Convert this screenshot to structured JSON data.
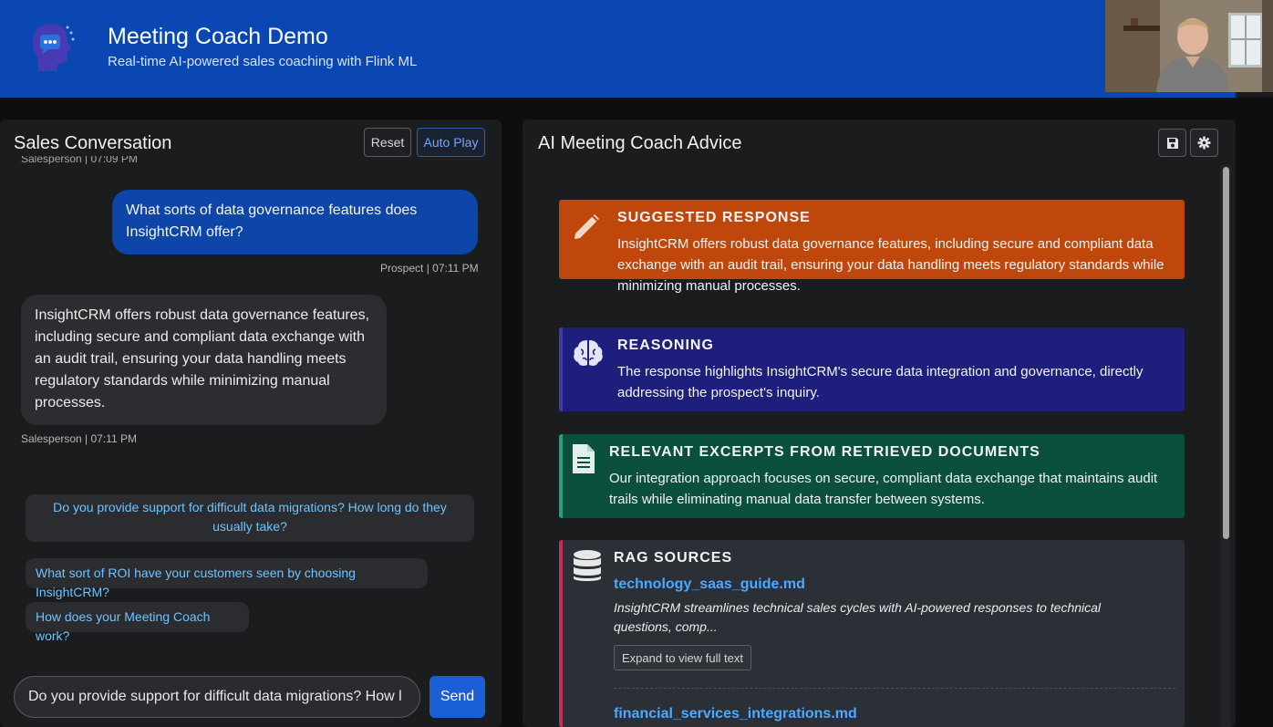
{
  "header": {
    "title": "Meeting Coach Demo",
    "subtitle": "Real-time AI-powered sales coaching with Flink ML"
  },
  "conversation": {
    "title": "Sales Conversation",
    "reset_label": "Reset",
    "autoplay_label": "Auto Play",
    "clipped_meta": "Salesperson | 07:09 PM",
    "messages": [
      {
        "role": "prospect",
        "text": "What sorts of data governance features does InsightCRM offer?",
        "meta": "Prospect | 07:11 PM"
      },
      {
        "role": "salesperson",
        "text": "InsightCRM offers robust data governance features, including secure and compliant data exchange with an audit trail, ensuring your data handling meets regulatory standards while minimizing manual processes.",
        "meta": "Salesperson | 07:11 PM"
      }
    ],
    "suggestions": [
      "Do you provide support for difficult data migrations? How long do they usually take?",
      "What sort of ROI have your customers seen by choosing InsightCRM?",
      "How does your Meeting Coach work?"
    ],
    "input_value": "Do you provide support for difficult data migrations? How l",
    "send_label": "Send"
  },
  "advice": {
    "title": "AI Meeting Coach Advice",
    "icons": {
      "save": "save-icon",
      "settings": "gear-icon"
    },
    "suggested": {
      "icon": "pencil-icon",
      "heading": "SUGGESTED RESPONSE",
      "text": "InsightCRM offers robust data governance features, including secure and compliant data exchange with an audit trail, ensuring your data handling meets regulatory standards while minimizing manual processes.",
      "color": "#c0470b"
    },
    "reasoning": {
      "icon": "brain-icon",
      "heading": "REASONING",
      "text": "The response highlights InsightCRM's secure data integration and governance, directly addressing the prospect's inquiry.",
      "color": "#1e1f7c"
    },
    "excerpts": {
      "icon": "document-icon",
      "heading": "RELEVANT EXCERPTS FROM RETRIEVED DOCUMENTS",
      "text": "Our integration approach focuses on secure, compliant data exchange that maintains audit trails while eliminating manual data transfer between systems.",
      "color": "#0b4f3e"
    },
    "rag": {
      "icon": "database-icon",
      "heading": "RAG SOURCES",
      "sources": [
        {
          "name": "technology_saas_guide.md",
          "snippet": "InsightCRM streamlines technical sales cycles with AI-powered responses to technical questions, comp...",
          "expand_label": "Expand to view full text"
        },
        {
          "name": "financial_services_integrations.md"
        }
      ]
    }
  },
  "colors": {
    "header_bg": "#0a47b3",
    "prospect_bubble": "#0d45a8",
    "accent_link": "#4ea8ff",
    "suggestion_text": "#6ec3ff"
  }
}
